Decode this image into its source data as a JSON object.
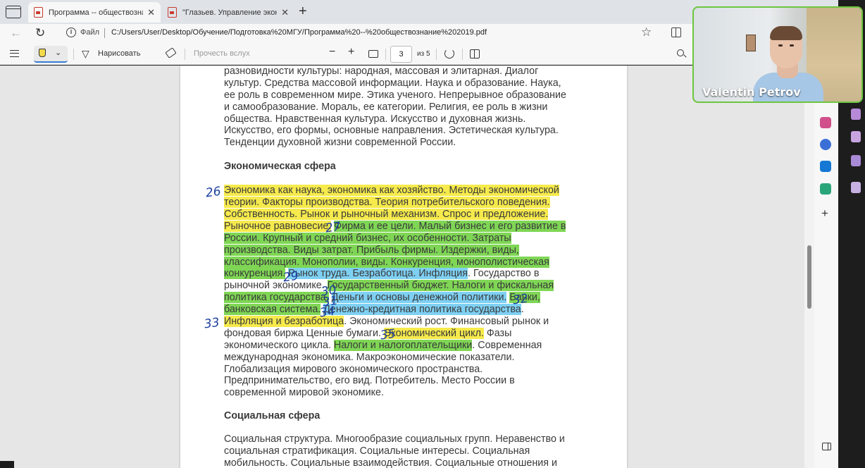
{
  "browser": {
    "tabs": [
      {
        "title": "Программа -- обществознание"
      },
      {
        "title": "\"Глазьев. Управление экономи"
      }
    ],
    "address": {
      "scheme_label": "Файл",
      "url": "C:/Users/User/Desktop/Обучение/Подготовка%20МГУ/Программа%20--%20обществознание%202019.pdf"
    }
  },
  "pdf_toolbar": {
    "draw_label": "Нарисовать",
    "read_aloud_label": "Прочесть вслух",
    "page_current": "3",
    "page_total": "из 5"
  },
  "document": {
    "culture_lines": [
      "разновидности культуры: народная, массовая и элитарная. Диалог",
      "культур. Средства массовой информации. Наука и образование. Наука,",
      "ее роль в современном мире. Этика ученого. Непрерывное образование",
      "и самообразование. Мораль, ее категории. Религия, ее роль в жизни",
      "общества. Нравственная культура. Искусство и духовная жизнь.",
      "Искусство, его формы, основные направления. Эстетическая культура.",
      "Тенденции духовной жизни современной России."
    ],
    "economic_heading": "Экономическая сфера",
    "economic": {
      "l1": "Экономика как наука, экономика как хозяйство. Методы экономической",
      "l2": "теории. Факторы производства. Теория потребительского поведения.",
      "l3": "Собственность. Рынок и рыночный механизм. Спрос и предложение.",
      "l4a": "Рыночное равновесие.",
      "l4b": "Фирма и ее цели. Малый бизнес и его развитие в",
      "l5": "России. Крупный и средний бизнес, их особенности. Затраты",
      "l6": "производства. Виды затрат. Прибыль фирмы. Издержки, виды,",
      "l7": "классификация. Монополии, виды. Конкуренция, монополистическая",
      "l8a": "конкуренция.",
      "l8b": "Рынок труда. Безработица. Инфляция",
      "l8c": ". Государство в",
      "l9a": "рыночной экономике.",
      "l9b": "Государственный бюджет. Налоги и фискальная",
      "l10a": "политика государства.",
      "l10b": "Деньги и основы денежной политики.",
      "l10c": "Банки,",
      "l11a": "банковская система.",
      "l11b": "Денежно-кредитная политика государства",
      "l11c": ".",
      "l12a": "Инфляция и безработица",
      "l12b": ". Экономический рост. Финансовый рынок и",
      "l13a": "фондовая биржа Ценные бумаги.",
      "l13b": "Экономический цикл.",
      "l13c": " Фазы",
      "l14a": "экономического цикла.",
      "l14b": "Налоги и налогоплательщики",
      "l14c": ". Современная",
      "l15": "международная экономика. Макроэкономические показатели.",
      "l16": "Глобализация мирового экономического пространства.",
      "l17": "Предпринимательство, его вид. Потребитель. Место России в",
      "l18": "современной мировой экономике."
    },
    "social_heading": "Социальная сфера",
    "social_lines": [
      "Социальная структура. Многообразие социальных групп. Неравенство и",
      "социальная стратификация. Социальные интересы. Социальная",
      "мобильность. Социальные взаимодействия. Социальные отношения и"
    ],
    "margin_notes": {
      "n26": "26",
      "n27": "27",
      "n29": "29",
      "n30": "30",
      "n31": "31",
      "n32": "32",
      "n33": "33",
      "n34": "34",
      "n35": "35"
    }
  },
  "webcam": {
    "participant_name": "Valentin Petrov"
  },
  "colors": {
    "highlight_yellow": "#f6ea4c",
    "highlight_green": "#7fd655",
    "highlight_blue": "#7ed0f3",
    "ink_blue": "#1c3f9f",
    "webcam_border": "#6cc63f"
  },
  "icons": {
    "tab_actions": "tab-actions-icon",
    "pdf_file": "pdf-file-icon",
    "back": "back-arrow-icon",
    "refresh": "refresh-icon",
    "info": "info-icon",
    "favorite": "star-icon",
    "split_screen": "split-screen-icon",
    "contents": "list-icon",
    "highlight": "highlighter-icon",
    "draw": "draw-icon",
    "erase": "eraser-icon",
    "zoom_out": "minus-icon",
    "zoom_in": "plus-icon",
    "fit_page": "fit-page-icon",
    "rotate": "rotate-icon",
    "page_view": "page-view-icon",
    "search": "search-icon"
  }
}
